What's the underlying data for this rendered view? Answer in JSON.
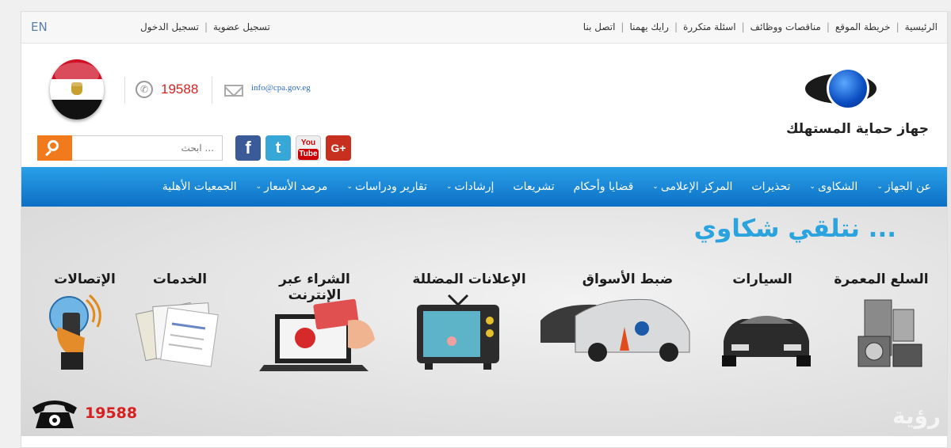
{
  "topbar": {
    "lang": "EN",
    "right_links": [
      "الرئيسية",
      "خريطة الموقع",
      "مناقصات ووظائف",
      "اسئلة متكررة",
      "رايك يهمنا",
      "اتصل بنا"
    ],
    "left_links": [
      "تسجيل عضوية",
      "تسجيل الدخول"
    ]
  },
  "header": {
    "phone": "19588",
    "email": "info@cpa.gov.eg",
    "search_placeholder": "ابحث ...",
    "logo_text": "جهاز حماية المستهلك",
    "social": {
      "gplus": "G+",
      "youtube_top": "You",
      "youtube_bottom": "Tube",
      "twitter": "t",
      "facebook": "f"
    }
  },
  "nav": [
    {
      "label": "عن الجهاز",
      "dropdown": true
    },
    {
      "label": "الشكاوى",
      "dropdown": true
    },
    {
      "label": "تحذيرات",
      "dropdown": false
    },
    {
      "label": "المركز الإعلامى",
      "dropdown": true
    },
    {
      "label": "قضايا وأحكام",
      "dropdown": false
    },
    {
      "label": "تشريعات",
      "dropdown": false
    },
    {
      "label": "إرشادات",
      "dropdown": true
    },
    {
      "label": "تقارير ودراسات",
      "dropdown": true
    },
    {
      "label": "مرصد الأسعار",
      "dropdown": true
    },
    {
      "label": "الجمعيات الأهلية",
      "dropdown": false
    }
  ],
  "banner": {
    "headline": "نتلقي شكاوي ...",
    "categories": [
      "السلع المعمرة",
      "السيارات",
      "ضبط الأسواق",
      "الإعلانات المضللة",
      "الشراء عبر الإنترنت",
      "الخدمات",
      "الإتصالات"
    ],
    "hotline": "19588",
    "colors": {
      "headline": "#2ba3de",
      "hotline": "#d61f1f",
      "nav_top": "#2aa0e8",
      "nav_bottom": "#0c6fc4",
      "search_button": "#f07a1c"
    }
  }
}
